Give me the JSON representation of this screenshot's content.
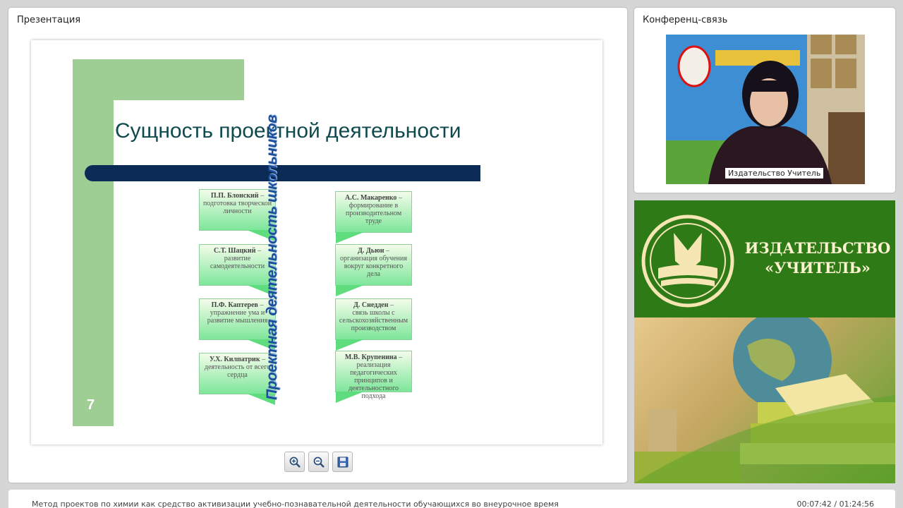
{
  "presentation": {
    "panel_title": "Презентация",
    "slide": {
      "title": "Сущность проектной деятельности",
      "number": "7",
      "vertical_text": "Проектная деятельность школьников",
      "left_callouts": [
        {
          "who": "П.П. Блонский",
          "text": "подготовка творческой личности"
        },
        {
          "who": "С.Т. Шацкий",
          "text": "развитие самодеятельности"
        },
        {
          "who": "П.Ф. Каптерев",
          "text": "упражнение ума и развитие мышления"
        },
        {
          "who": "У.Х. Килпатрик",
          "text": "деятельность от всего сердца"
        }
      ],
      "right_callouts": [
        {
          "who": "А.С. Макаренко",
          "text": "формирование в производительном труде"
        },
        {
          "who": "Д. Дьюи",
          "text": "организация обучения вокруг конкретного дела"
        },
        {
          "who": "Д. Снедден",
          "text": "связь школы с сельскохозяйственным производством"
        },
        {
          "who": "М.В. Крупенина",
          "text": "реализация педагогических принципов и деятельностного подхода"
        }
      ],
      "colors": {
        "green": "#9fce94",
        "navy": "#0b2a55",
        "title": "#0f4a4f"
      }
    },
    "toolbar": {
      "zoom_in_icon": "zoom-in-icon",
      "zoom_out_icon": "zoom-out-icon",
      "save_icon": "save-icon"
    }
  },
  "conference": {
    "panel_title": "Конференц-связь",
    "video_caption": "Издательство Учитель"
  },
  "banner": {
    "line1": "ИЗДАТЕЛЬСТВО",
    "line2": "«УЧИТЕЛЬ»"
  },
  "footer": {
    "title": "Метод проектов по химии как средство активизации учебно-познавательной деятельности обучающихся во внеурочное время",
    "time": "00:07:42 / 01:24:56"
  }
}
